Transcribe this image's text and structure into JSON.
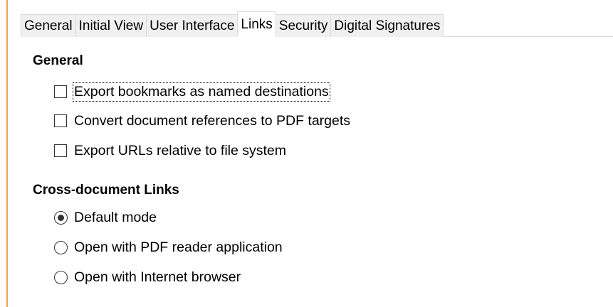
{
  "tabs": [
    {
      "label": "General",
      "active": false
    },
    {
      "label": "Initial View",
      "active": false
    },
    {
      "label": "User Interface",
      "active": false
    },
    {
      "label": "Links",
      "active": true
    },
    {
      "label": "Security",
      "active": false
    },
    {
      "label": "Digital Signatures",
      "active": false
    }
  ],
  "general": {
    "title": "General",
    "options": [
      {
        "label": "Export bookmarks as named destinations",
        "checked": false
      },
      {
        "label": "Convert document references to PDF targets",
        "checked": false
      },
      {
        "label": "Export URLs relative to file system",
        "checked": false
      }
    ]
  },
  "cross_document": {
    "title": "Cross-document Links",
    "options": [
      {
        "label": "Default mode",
        "selected": true
      },
      {
        "label": "Open with PDF reader application",
        "selected": false
      },
      {
        "label": "Open with Internet browser",
        "selected": false
      }
    ]
  },
  "colors": {
    "accent_bar": "#f0a35a",
    "tab_inactive_bg": "#f0f0f0",
    "tab_border": "#d9d9d9"
  }
}
